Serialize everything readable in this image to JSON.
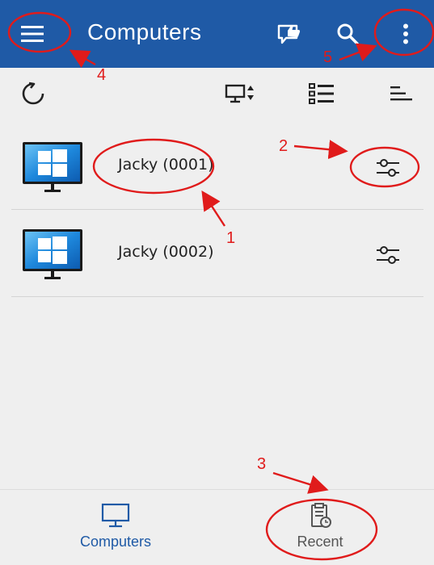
{
  "appbar": {
    "title": "Computers",
    "menu_icon": "hamburger-menu-icon",
    "like_icon": "thumbs-up-icon",
    "search_icon": "search-icon",
    "more_icon": "more-vert-icon",
    "color": "#1f5aa6"
  },
  "toolbar": {
    "refresh_icon": "refresh-icon",
    "sort_icon": "monitor-sort-icon",
    "view_icon": "list-view-icon",
    "filter_icon": "sort-lines-icon"
  },
  "computers": [
    {
      "name": "Jacky (0001)",
      "icon": "windows-monitor-icon",
      "settings_icon": "settings-sliders-icon"
    },
    {
      "name": "Jacky (0002)",
      "icon": "windows-monitor-icon",
      "settings_icon": "settings-sliders-icon"
    }
  ],
  "bottom_nav": {
    "items": [
      {
        "label": "Computers",
        "icon": "monitor-icon",
        "active": true
      },
      {
        "label": "Recent",
        "icon": "clipboard-clock-icon",
        "active": false
      }
    ],
    "active_color": "#1f5aa6",
    "inactive_color": "#555555"
  },
  "annotations": {
    "color": "#e01b1b",
    "labels": [
      "1",
      "2",
      "3",
      "4",
      "5"
    ]
  }
}
